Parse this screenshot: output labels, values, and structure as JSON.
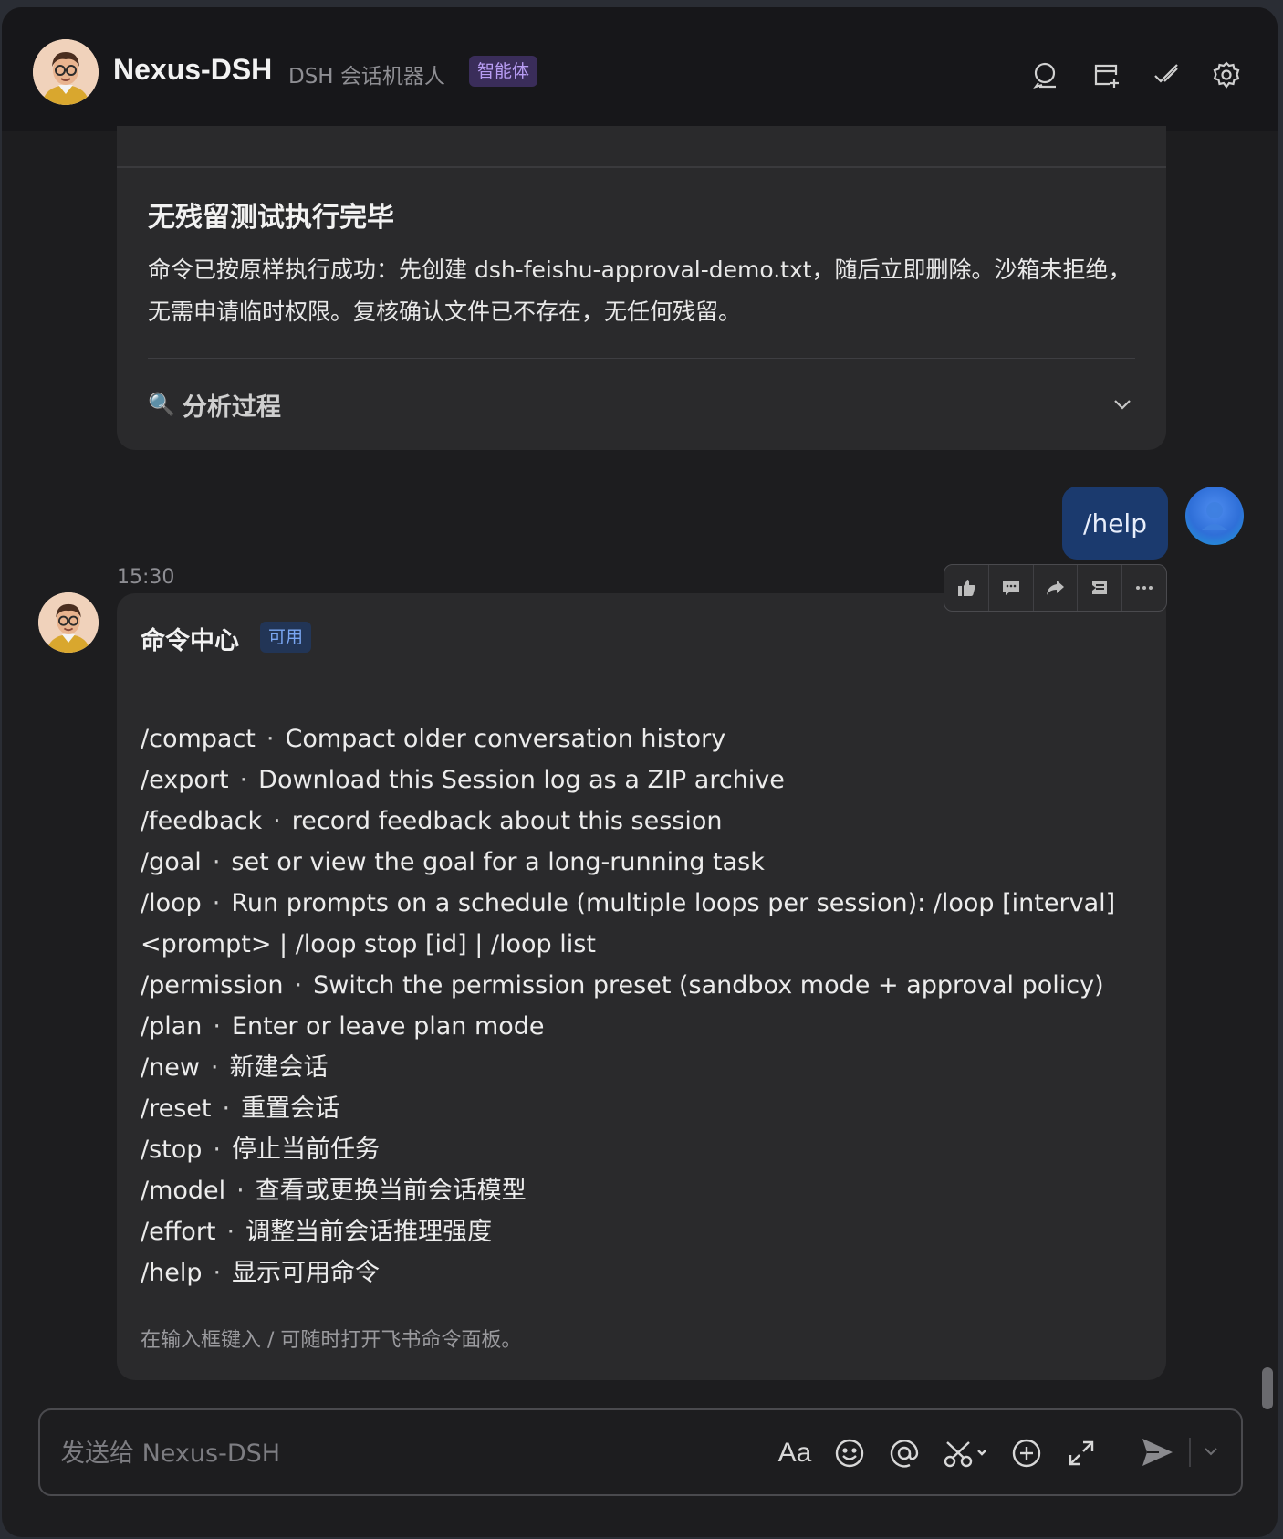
{
  "header": {
    "bot_name": "Nexus-DSH",
    "bot_subtitle": "DSH 会话机器人",
    "agent_badge": "智能体",
    "icons": [
      "search-chat-icon",
      "new-tab-icon",
      "checkmark-pen-icon",
      "gear-icon"
    ]
  },
  "previous_card": {
    "title": "无残留测试执行完毕",
    "body": "命令已按原样执行成功：先创建 dsh-feishu-approval-demo.txt，随后立即删除。沙箱未拒绝，无需申请临时权限。复核确认文件已不存在，无任何残留。",
    "analysis_label": "分析过程",
    "analysis_icon": "magnifier-icon"
  },
  "user_message": {
    "text": "/help"
  },
  "reply": {
    "timestamp": "15:30",
    "title": "命令中心",
    "status_badge": "可用",
    "action_icons": [
      "thumbs-up-icon",
      "comment-icon",
      "forward-icon",
      "quote-icon",
      "more-icon"
    ],
    "commands": [
      {
        "cmd": "/compact",
        "desc": "Compact older conversation history"
      },
      {
        "cmd": "/export",
        "desc": "Download this Session log as a ZIP archive"
      },
      {
        "cmd": "/feedback",
        "desc": "record feedback about this session"
      },
      {
        "cmd": "/goal",
        "desc": "set or view the goal for a long-running task"
      },
      {
        "cmd": "/loop",
        "desc": "Run prompts on a schedule (multiple loops per session): /loop [interval] <prompt> | /loop stop [id] | /loop list"
      },
      {
        "cmd": "/permission",
        "desc": "Switch the permission preset (sandbox mode + approval policy)"
      },
      {
        "cmd": "/plan",
        "desc": "Enter or leave plan mode"
      },
      {
        "cmd": "/new",
        "desc": "新建会话"
      },
      {
        "cmd": "/reset",
        "desc": "重置会话"
      },
      {
        "cmd": "/stop",
        "desc": "停止当前任务"
      },
      {
        "cmd": "/model",
        "desc": "查看或更换当前会话模型"
      },
      {
        "cmd": "/effort",
        "desc": "调整当前会话推理强度"
      },
      {
        "cmd": "/help",
        "desc": "显示可用命令"
      }
    ],
    "separator": "·",
    "footer": "在输入框键入 / 可随时打开飞书命令面板。"
  },
  "composer": {
    "placeholder": "发送给 Nexus-DSH",
    "format_label": "Aa",
    "tool_icons": [
      "text-format-icon",
      "emoji-icon",
      "mention-icon",
      "screenshot-scissors-icon",
      "add-icon",
      "expand-icon"
    ],
    "send_icon": "send-icon"
  },
  "colors": {
    "background": "#1d1d1f",
    "card": "#2a2a2c",
    "user_bubble": "#1b3a6e",
    "agent_badge_bg": "#3a2d5a",
    "agent_badge_fg": "#b79cf3",
    "status_badge_bg": "#223556",
    "status_badge_fg": "#7aa6f2"
  }
}
